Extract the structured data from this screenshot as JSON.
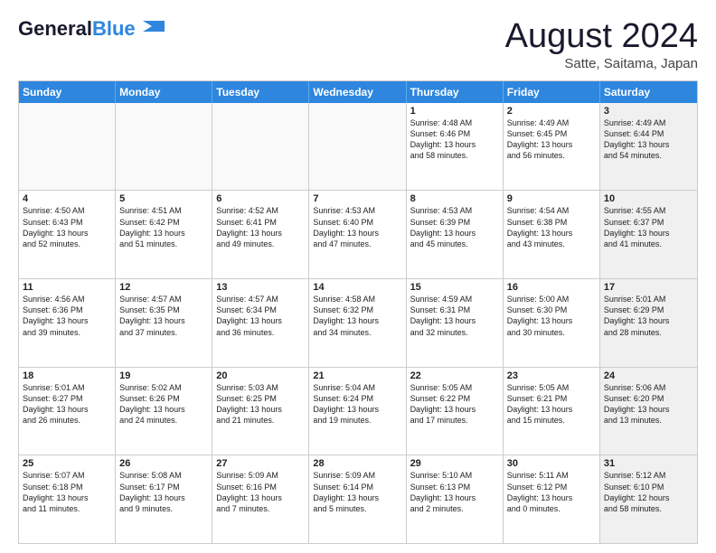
{
  "logo": {
    "line1": "General",
    "line2": "Blue"
  },
  "header": {
    "month": "August 2024",
    "location": "Satte, Saitama, Japan"
  },
  "weekdays": [
    "Sunday",
    "Monday",
    "Tuesday",
    "Wednesday",
    "Thursday",
    "Friday",
    "Saturday"
  ],
  "rows": [
    [
      {
        "day": "",
        "text": "",
        "empty": true
      },
      {
        "day": "",
        "text": "",
        "empty": true
      },
      {
        "day": "",
        "text": "",
        "empty": true
      },
      {
        "day": "",
        "text": "",
        "empty": true
      },
      {
        "day": "1",
        "text": "Sunrise: 4:48 AM\nSunset: 6:46 PM\nDaylight: 13 hours\nand 58 minutes."
      },
      {
        "day": "2",
        "text": "Sunrise: 4:49 AM\nSunset: 6:45 PM\nDaylight: 13 hours\nand 56 minutes."
      },
      {
        "day": "3",
        "text": "Sunrise: 4:49 AM\nSunset: 6:44 PM\nDaylight: 13 hours\nand 54 minutes.",
        "shaded": true
      }
    ],
    [
      {
        "day": "4",
        "text": "Sunrise: 4:50 AM\nSunset: 6:43 PM\nDaylight: 13 hours\nand 52 minutes."
      },
      {
        "day": "5",
        "text": "Sunrise: 4:51 AM\nSunset: 6:42 PM\nDaylight: 13 hours\nand 51 minutes."
      },
      {
        "day": "6",
        "text": "Sunrise: 4:52 AM\nSunset: 6:41 PM\nDaylight: 13 hours\nand 49 minutes."
      },
      {
        "day": "7",
        "text": "Sunrise: 4:53 AM\nSunset: 6:40 PM\nDaylight: 13 hours\nand 47 minutes."
      },
      {
        "day": "8",
        "text": "Sunrise: 4:53 AM\nSunset: 6:39 PM\nDaylight: 13 hours\nand 45 minutes."
      },
      {
        "day": "9",
        "text": "Sunrise: 4:54 AM\nSunset: 6:38 PM\nDaylight: 13 hours\nand 43 minutes."
      },
      {
        "day": "10",
        "text": "Sunrise: 4:55 AM\nSunset: 6:37 PM\nDaylight: 13 hours\nand 41 minutes.",
        "shaded": true
      }
    ],
    [
      {
        "day": "11",
        "text": "Sunrise: 4:56 AM\nSunset: 6:36 PM\nDaylight: 13 hours\nand 39 minutes."
      },
      {
        "day": "12",
        "text": "Sunrise: 4:57 AM\nSunset: 6:35 PM\nDaylight: 13 hours\nand 37 minutes."
      },
      {
        "day": "13",
        "text": "Sunrise: 4:57 AM\nSunset: 6:34 PM\nDaylight: 13 hours\nand 36 minutes."
      },
      {
        "day": "14",
        "text": "Sunrise: 4:58 AM\nSunset: 6:32 PM\nDaylight: 13 hours\nand 34 minutes."
      },
      {
        "day": "15",
        "text": "Sunrise: 4:59 AM\nSunset: 6:31 PM\nDaylight: 13 hours\nand 32 minutes."
      },
      {
        "day": "16",
        "text": "Sunrise: 5:00 AM\nSunset: 6:30 PM\nDaylight: 13 hours\nand 30 minutes."
      },
      {
        "day": "17",
        "text": "Sunrise: 5:01 AM\nSunset: 6:29 PM\nDaylight: 13 hours\nand 28 minutes.",
        "shaded": true
      }
    ],
    [
      {
        "day": "18",
        "text": "Sunrise: 5:01 AM\nSunset: 6:27 PM\nDaylight: 13 hours\nand 26 minutes."
      },
      {
        "day": "19",
        "text": "Sunrise: 5:02 AM\nSunset: 6:26 PM\nDaylight: 13 hours\nand 24 minutes."
      },
      {
        "day": "20",
        "text": "Sunrise: 5:03 AM\nSunset: 6:25 PM\nDaylight: 13 hours\nand 21 minutes."
      },
      {
        "day": "21",
        "text": "Sunrise: 5:04 AM\nSunset: 6:24 PM\nDaylight: 13 hours\nand 19 minutes."
      },
      {
        "day": "22",
        "text": "Sunrise: 5:05 AM\nSunset: 6:22 PM\nDaylight: 13 hours\nand 17 minutes."
      },
      {
        "day": "23",
        "text": "Sunrise: 5:05 AM\nSunset: 6:21 PM\nDaylight: 13 hours\nand 15 minutes."
      },
      {
        "day": "24",
        "text": "Sunrise: 5:06 AM\nSunset: 6:20 PM\nDaylight: 13 hours\nand 13 minutes.",
        "shaded": true
      }
    ],
    [
      {
        "day": "25",
        "text": "Sunrise: 5:07 AM\nSunset: 6:18 PM\nDaylight: 13 hours\nand 11 minutes."
      },
      {
        "day": "26",
        "text": "Sunrise: 5:08 AM\nSunset: 6:17 PM\nDaylight: 13 hours\nand 9 minutes."
      },
      {
        "day": "27",
        "text": "Sunrise: 5:09 AM\nSunset: 6:16 PM\nDaylight: 13 hours\nand 7 minutes."
      },
      {
        "day": "28",
        "text": "Sunrise: 5:09 AM\nSunset: 6:14 PM\nDaylight: 13 hours\nand 5 minutes."
      },
      {
        "day": "29",
        "text": "Sunrise: 5:10 AM\nSunset: 6:13 PM\nDaylight: 13 hours\nand 2 minutes."
      },
      {
        "day": "30",
        "text": "Sunrise: 5:11 AM\nSunset: 6:12 PM\nDaylight: 13 hours\nand 0 minutes."
      },
      {
        "day": "31",
        "text": "Sunrise: 5:12 AM\nSunset: 6:10 PM\nDaylight: 12 hours\nand 58 minutes.",
        "shaded": true
      }
    ]
  ]
}
